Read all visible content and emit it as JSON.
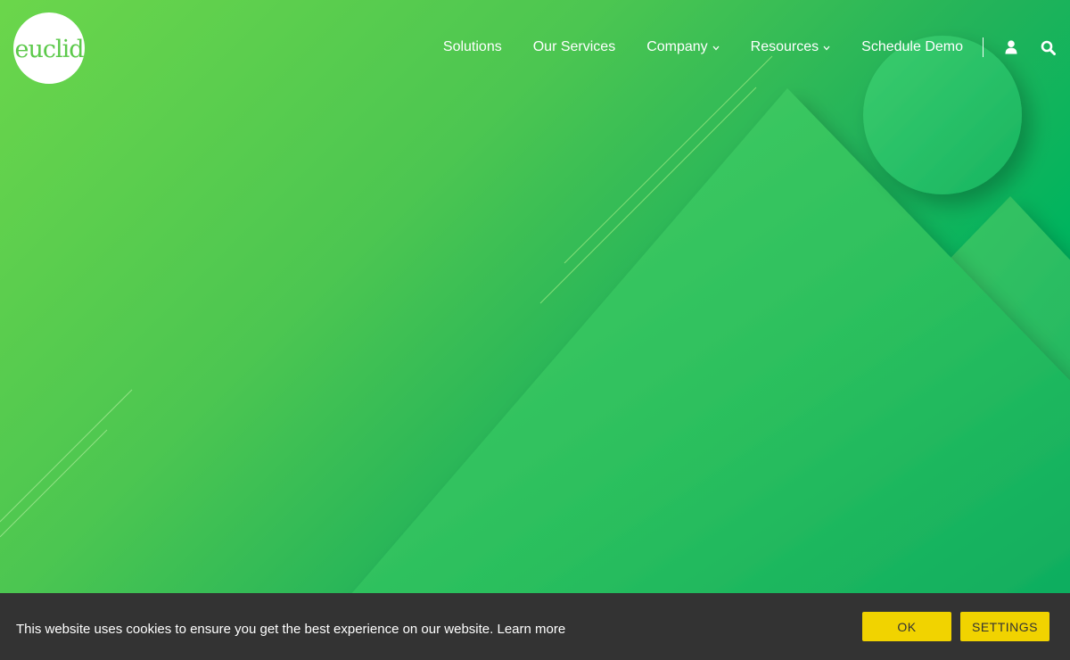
{
  "brand": {
    "logo_text": "euclid",
    "logo_color": "#5cc94b"
  },
  "nav": {
    "items": [
      {
        "label": "Solutions",
        "has_dropdown": false
      },
      {
        "label": "Our Services",
        "has_dropdown": false
      },
      {
        "label": "Company",
        "has_dropdown": true
      },
      {
        "label": "Resources",
        "has_dropdown": true
      },
      {
        "label": "Schedule Demo",
        "has_dropdown": false
      }
    ],
    "icons": [
      "user-icon",
      "search-icon"
    ]
  },
  "hero": {
    "gradient_start": "#6bd64b",
    "gradient_end": "#029e66"
  },
  "cookie": {
    "message": "This website uses cookies to ensure you get the best experience on our website.",
    "learn_more": "Learn more",
    "ok_label": "OK",
    "settings_label": "SETTINGS",
    "bar_color": "#333333",
    "button_color": "#f1d300"
  }
}
